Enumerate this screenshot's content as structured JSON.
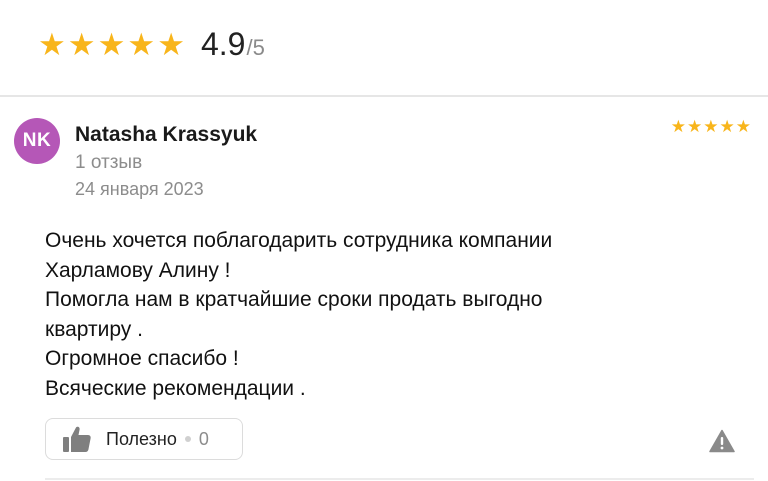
{
  "summary": {
    "stars": [
      "★",
      "★",
      "★",
      "★",
      "★"
    ],
    "score": "4.9",
    "score_max": "/5",
    "star_color": "#f8b51b"
  },
  "review": {
    "avatar_initials": "NK",
    "avatar_color": "#b557b7",
    "author": "Natasha Krassyuk",
    "reviews_count": "1 отзыв",
    "date": "24 января 2023",
    "rating_stars": [
      "★",
      "★",
      "★",
      "★",
      "★"
    ],
    "text_lines": [
      "Очень хочется поблагодарить сотрудника компании",
      "Харламову Алину !",
      "Помогла нам в кратчайшие сроки продать выгодно",
      "квартиру .",
      "Огромное спасибо !",
      "Всяческие рекомендации ."
    ],
    "helpful_label": "Полезно",
    "helpful_count": "0",
    "helpful_icon": "thumbs-up-icon",
    "report_icon": "warning-triangle-icon"
  }
}
